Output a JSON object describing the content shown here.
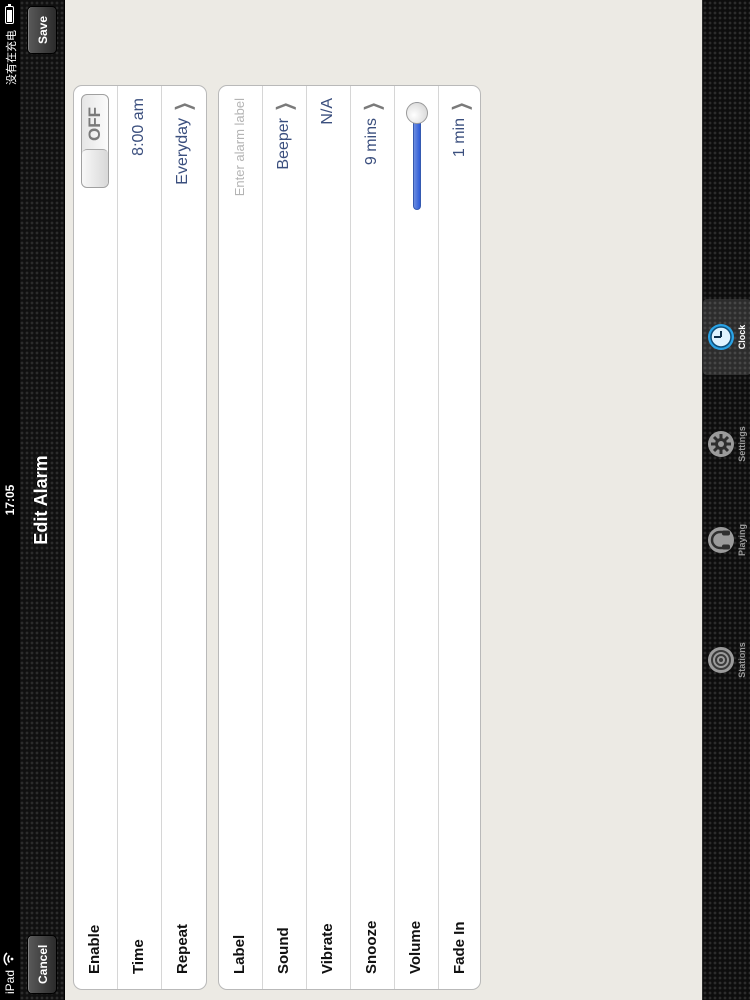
{
  "status_bar": {
    "carrier": "iPad",
    "time": "17:05",
    "charge_text": "没有在充电"
  },
  "nav_bar": {
    "cancel_label": "Cancel",
    "title": "Edit Alarm",
    "save_label": "Save"
  },
  "alarm_group": {
    "enable": {
      "label": "Enable",
      "toggle_text": "OFF",
      "state": "off"
    },
    "time": {
      "label": "Time",
      "value": "8:00 am"
    },
    "repeat": {
      "label": "Repeat",
      "value": "Everyday"
    }
  },
  "options_group": {
    "label": {
      "label": "Label",
      "placeholder": "Enter alarm label"
    },
    "sound": {
      "label": "Sound",
      "value": "Beeper"
    },
    "vibrate": {
      "label": "Vibrate",
      "value": "N/A"
    },
    "snooze": {
      "label": "Snooze",
      "value": "9 mins"
    },
    "volume": {
      "label": "Volume",
      "level": 1.0
    },
    "fade_in": {
      "label": "Fade In",
      "value": "1 min"
    }
  },
  "tab_bar": {
    "tabs": [
      {
        "label": "Stations",
        "icon": "stations-icon",
        "active": false
      },
      {
        "label": "Playing",
        "icon": "headphones-icon",
        "active": false
      },
      {
        "label": "Settings",
        "icon": "gear-icon",
        "active": false
      },
      {
        "label": "Clock",
        "icon": "clock-icon",
        "active": true
      }
    ]
  },
  "colors": {
    "background": "#eceae4",
    "value_text": "#3b4f7e",
    "slider_fill": "#2d5bd8",
    "clock_accent": "#2aa3e6"
  }
}
